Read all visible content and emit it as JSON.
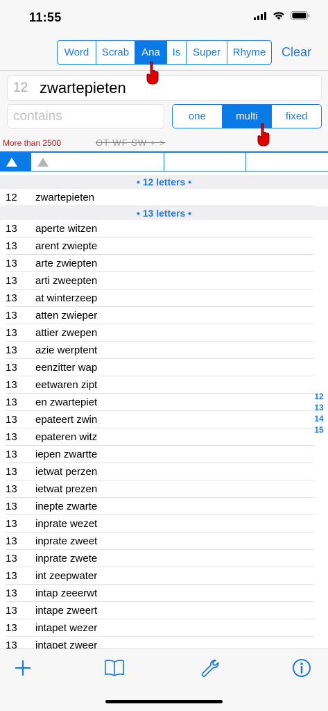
{
  "status_bar": {
    "time": "11:55"
  },
  "mode_tabs": [
    {
      "label": "Word",
      "active": false
    },
    {
      "label": "Scrab",
      "active": false
    },
    {
      "label": "Ana",
      "active": true
    },
    {
      "label": "Is",
      "active": false
    },
    {
      "label": "Super",
      "active": false
    },
    {
      "label": "Rhyme",
      "active": false
    }
  ],
  "clear_label": "Clear",
  "search": {
    "letter_count": "12",
    "word": "zwartepieten",
    "contains_placeholder": "contains",
    "contains_value": ""
  },
  "match_modes": [
    {
      "label": "one",
      "active": false
    },
    {
      "label": "multi",
      "active": true
    },
    {
      "label": "fixed",
      "active": false
    }
  ],
  "info": {
    "result_count": "More than 2500",
    "word_lists": "OT WF SW + >"
  },
  "sections": [
    {
      "header": "• 12 letters •",
      "rows": [
        {
          "len": "12",
          "word": "zwartepieten"
        }
      ]
    },
    {
      "header": "• 13 letters •",
      "rows": [
        {
          "len": "13",
          "word": "aperte witzen"
        },
        {
          "len": "13",
          "word": "arent zwiepte"
        },
        {
          "len": "13",
          "word": "arte zwiepten"
        },
        {
          "len": "13",
          "word": "arti zweepten"
        },
        {
          "len": "13",
          "word": "at winterzeep"
        },
        {
          "len": "13",
          "word": "atten zwieper"
        },
        {
          "len": "13",
          "word": "attier zwepen"
        },
        {
          "len": "13",
          "word": "azie werptent"
        },
        {
          "len": "13",
          "word": "eenzitter wap"
        },
        {
          "len": "13",
          "word": "eetwaren zipt"
        },
        {
          "len": "13",
          "word": "en zwartepiet"
        },
        {
          "len": "13",
          "word": "epateert zwin"
        },
        {
          "len": "13",
          "word": "epateren witz"
        },
        {
          "len": "13",
          "word": "iepen zwartte"
        },
        {
          "len": "13",
          "word": "ietwat perzen"
        },
        {
          "len": "13",
          "word": "ietwat prezen"
        },
        {
          "len": "13",
          "word": "inepte zwarte"
        },
        {
          "len": "13",
          "word": "inprate wezet"
        },
        {
          "len": "13",
          "word": "inprate zweet"
        },
        {
          "len": "13",
          "word": "inprate zwete"
        },
        {
          "len": "13",
          "word": "int zeepwater"
        },
        {
          "len": "13",
          "word": "intap zeeerwt"
        },
        {
          "len": "13",
          "word": "intape zweert"
        },
        {
          "len": "13",
          "word": "intapet wezer"
        },
        {
          "len": "13",
          "word": "intapet zweer"
        }
      ]
    }
  ],
  "index": [
    "12",
    "13",
    "14",
    "15"
  ],
  "colors": {
    "accent": "#1f7ae0",
    "active": "#0a7ae6",
    "warning": "#c0161c",
    "pointer": "#e00000"
  },
  "icons": {
    "add": "plus-icon",
    "book": "book-icon",
    "settings": "wrench-icon",
    "info": "info-icon"
  }
}
